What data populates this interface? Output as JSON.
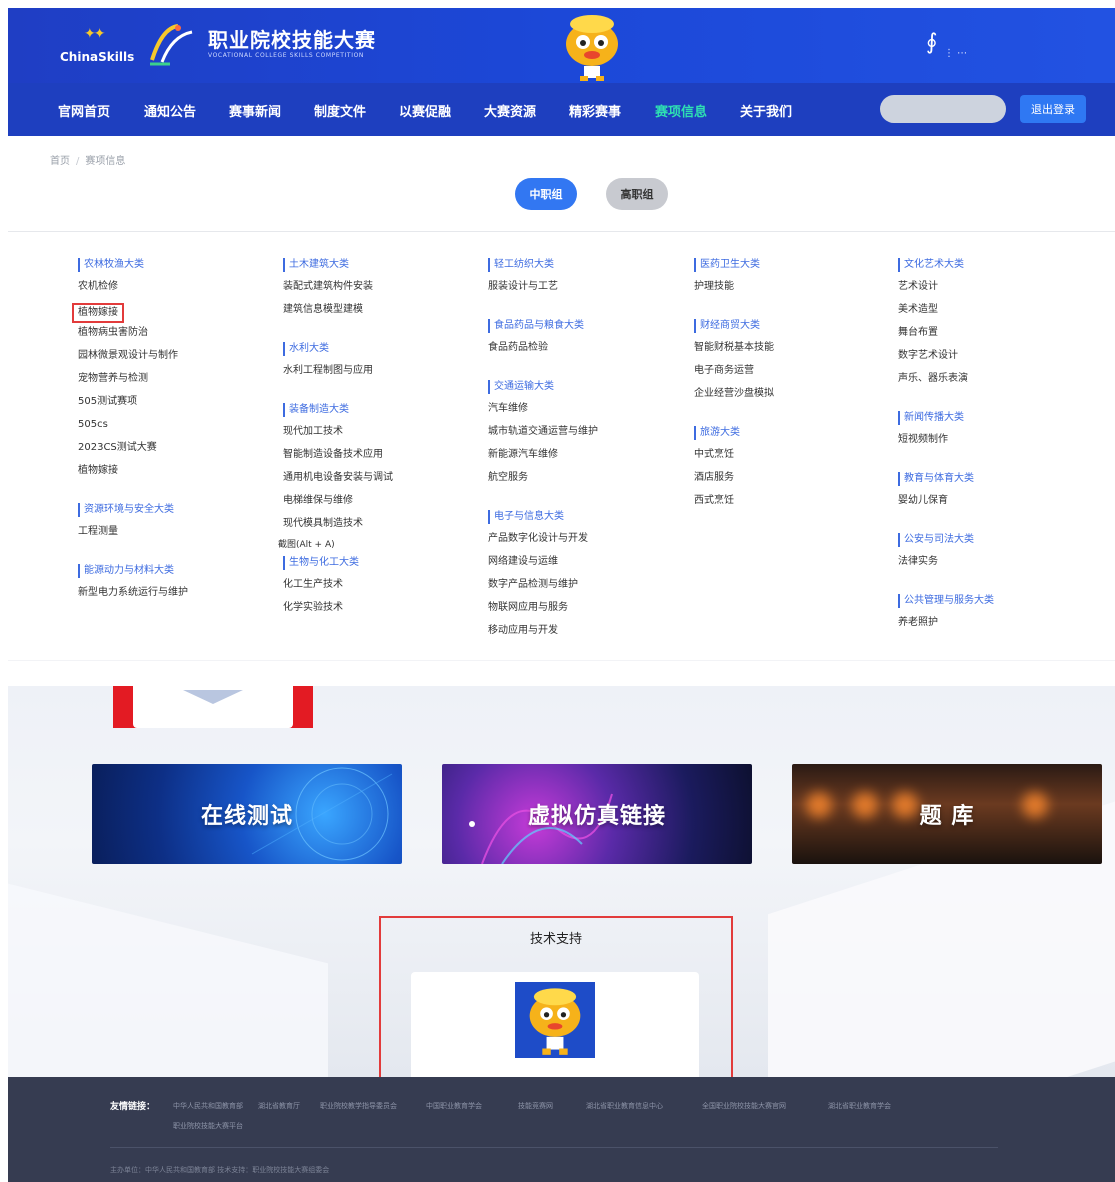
{
  "header": {
    "chinaskills_text": "ChinaSkills",
    "brand_title": "职业院校技能大赛",
    "brand_subtitle": "VOCATIONAL COLLEGE SKILLS COMPETITION"
  },
  "nav": {
    "items": [
      "官网首页",
      "通知公告",
      "赛事新闻",
      "制度文件",
      "以赛促融",
      "大赛资源",
      "精彩赛事",
      "赛项信息",
      "关于我们"
    ],
    "active_index": 7,
    "login_label": "退出登录"
  },
  "breadcrumb": {
    "home": "首页",
    "current": "赛项信息"
  },
  "levels": {
    "mid": "中职组",
    "high": "高职组"
  },
  "columns": [
    {
      "groups": [
        {
          "head": "农林牧渔大类",
          "items": [
            "农机检修",
            "植物嫁接",
            "植物病虫害防治",
            "园林微景观设计与制作",
            "宠物营养与检测",
            "505测试赛项",
            "505cs",
            "2023CS测试大赛",
            "植物嫁接"
          ]
        },
        {
          "head": "资源环境与安全大类",
          "items": [
            "工程测量"
          ]
        },
        {
          "head": "能源动力与材料大类",
          "items": [
            "新型电力系统运行与维护"
          ]
        }
      ]
    },
    {
      "groups": [
        {
          "head": "土木建筑大类",
          "items": [
            "装配式建筑构件安装",
            "建筑信息模型建模"
          ]
        },
        {
          "head": "水利大类",
          "items": [
            "水利工程制图与应用"
          ]
        },
        {
          "head": "装备制造大类",
          "items": [
            "现代加工技术",
            "智能制造设备技术应用",
            "通用机电设备安装与调试",
            "电梯维保与维修",
            "现代模具制造技术"
          ]
        },
        {
          "head": "生物与化工大类",
          "items": [
            "化工生产技术",
            "化学实验技术"
          ]
        }
      ]
    },
    {
      "groups": [
        {
          "head": "轻工纺织大类",
          "items": [
            "服装设计与工艺"
          ]
        },
        {
          "head": "食品药品与粮食大类",
          "items": [
            "食品药品检验"
          ]
        },
        {
          "head": "交通运输大类",
          "items": [
            "汽车维修",
            "城市轨道交通运营与维护",
            "新能源汽车维修",
            "航空服务"
          ]
        },
        {
          "head": "电子与信息大类",
          "items": [
            "产品数字化设计与开发",
            "网络建设与运维",
            "数字产品检测与维护",
            "物联网应用与服务",
            "移动应用与开发"
          ]
        }
      ]
    },
    {
      "groups": [
        {
          "head": "医药卫生大类",
          "items": [
            "护理技能"
          ]
        },
        {
          "head": "财经商贸大类",
          "items": [
            "智能财税基本技能",
            "电子商务运营",
            "企业经营沙盘模拟"
          ]
        },
        {
          "head": "旅游大类",
          "items": [
            "中式烹饪",
            "酒店服务",
            "西式烹饪"
          ]
        }
      ]
    },
    {
      "groups": [
        {
          "head": "文化艺术大类",
          "items": [
            "艺术设计",
            "美术造型",
            "舞台布置",
            "数字艺术设计",
            "声乐、器乐表演"
          ]
        },
        {
          "head": "新闻传播大类",
          "items": [
            "短视频制作"
          ]
        },
        {
          "head": "教育与体育大类",
          "items": [
            "婴幼儿保育"
          ]
        },
        {
          "head": "公安与司法大类",
          "items": [
            "法律实务"
          ]
        },
        {
          "head": "公共管理与服务大类",
          "items": [
            "养老照护"
          ]
        }
      ]
    }
  ],
  "tooltip": "截图(Alt + A)",
  "banners": [
    "在线测试",
    "虚拟仿真链接",
    "题 库"
  ],
  "support_title": "技术支持",
  "footer": {
    "friend_label": "友情链接：",
    "links": [
      "中华人民共和国教育部",
      "湖北省教育厅",
      "职业院校教学指导委员会",
      "中国职业教育学会",
      "技能竞赛网",
      "湖北省职业教育信息中心",
      "全国职业院校技能大赛官网",
      "湖北省职业教育学会",
      "职业院校技能大赛平台"
    ],
    "copyright": "主办单位：中华人民共和国教育部  技术支持：职业院校技能大赛组委会"
  }
}
